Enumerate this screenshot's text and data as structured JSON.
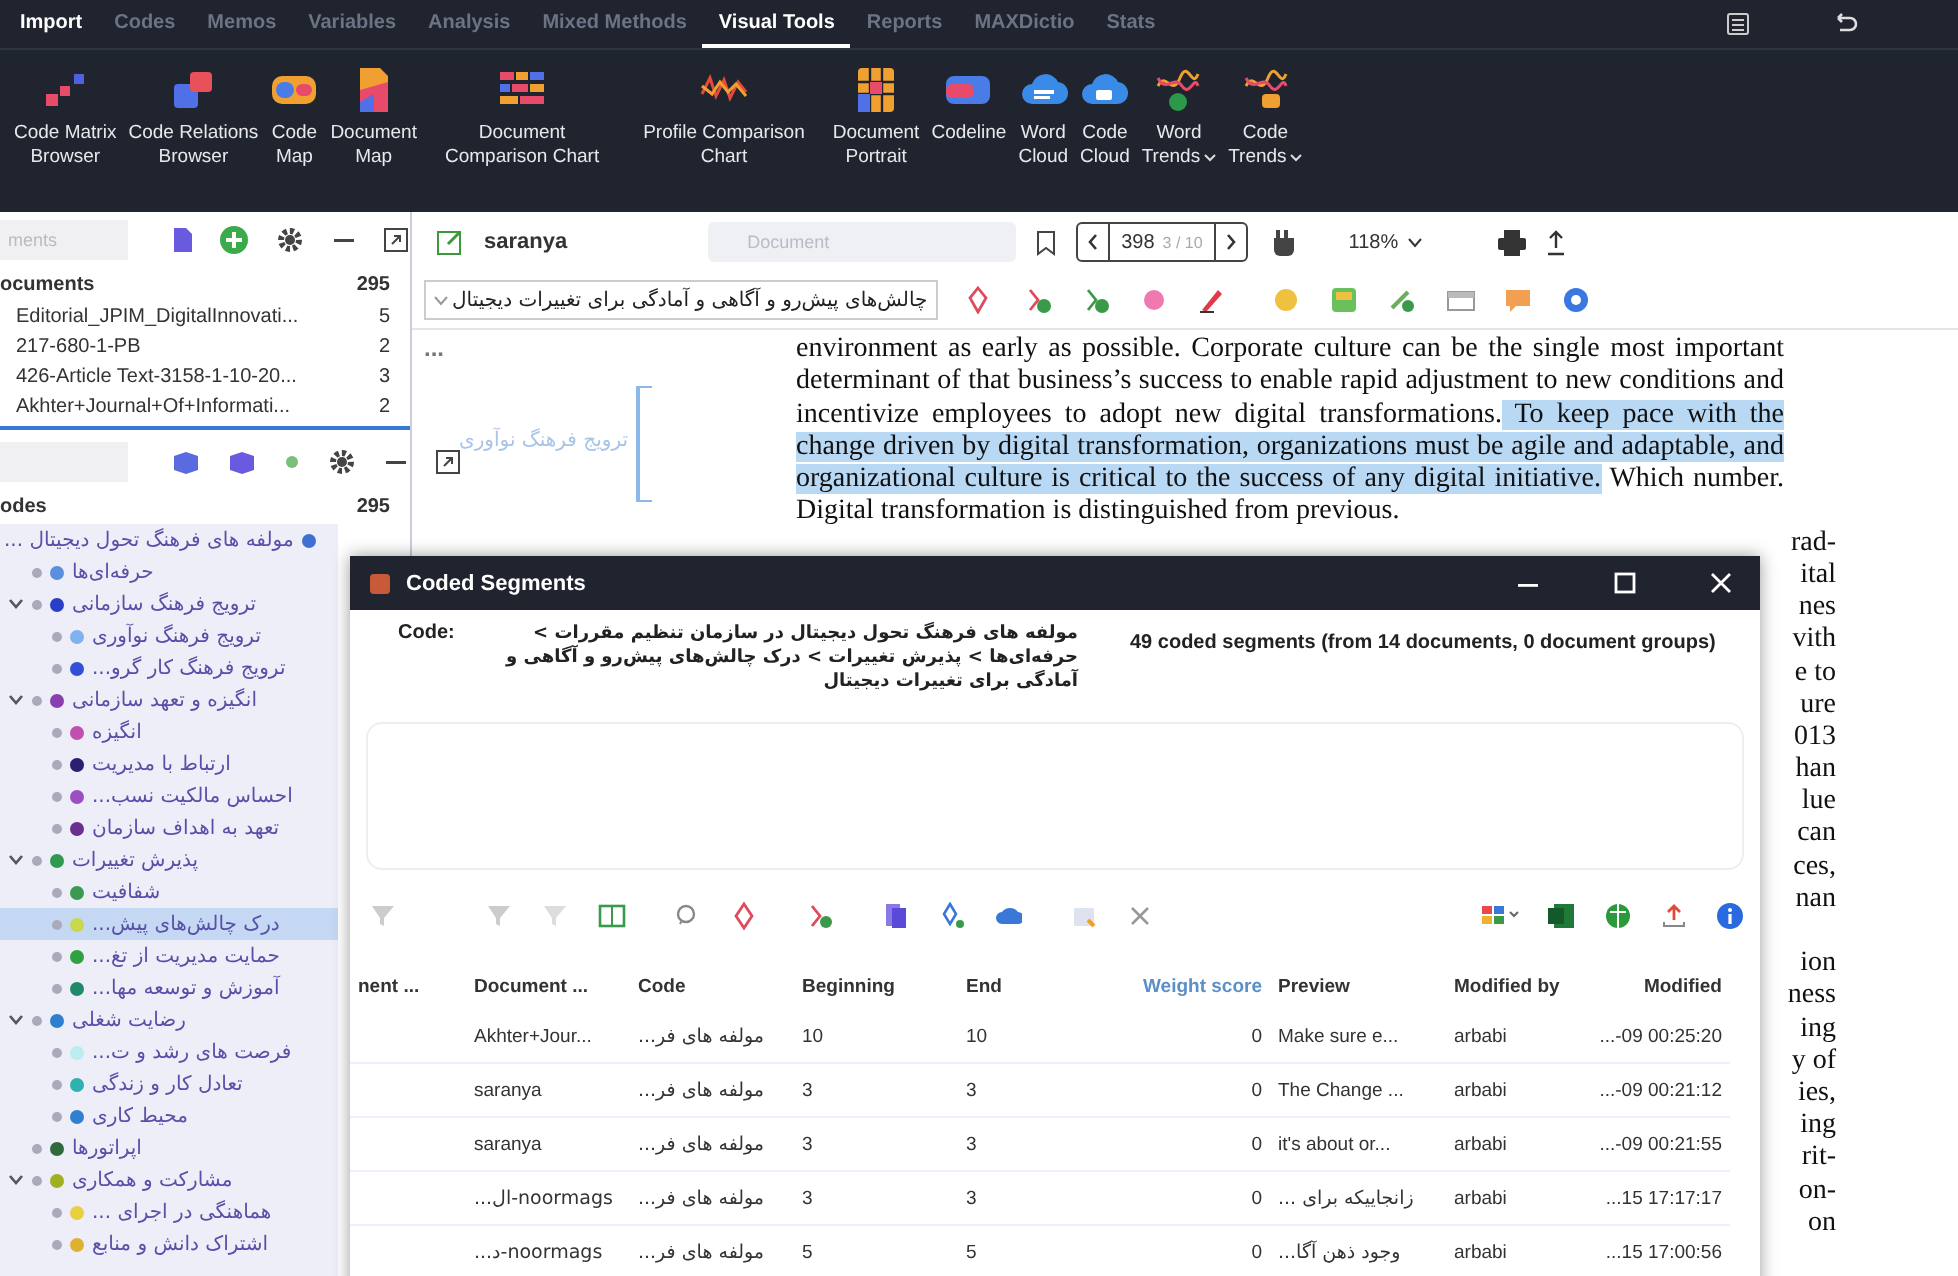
{
  "menu": {
    "tabs": [
      {
        "label": "Import",
        "selected": false
      },
      {
        "label": "Codes",
        "selected": false
      },
      {
        "label": "Memos",
        "selected": false
      },
      {
        "label": "Variables",
        "selected": false
      },
      {
        "label": "Analysis",
        "selected": false
      },
      {
        "label": "Mixed Methods",
        "selected": false
      },
      {
        "label": "Visual Tools",
        "selected": true
      },
      {
        "label": "Reports",
        "selected": false
      },
      {
        "label": "MAXDictio",
        "selected": false
      },
      {
        "label": "Stats",
        "selected": false
      }
    ]
  },
  "ribbon": [
    {
      "lines": [
        "Code Matrix",
        "Browser"
      ],
      "has_menu": false
    },
    {
      "lines": [
        "Code Relations",
        "Browser"
      ],
      "has_menu": false
    },
    {
      "lines": [
        "Code",
        "Map"
      ],
      "has_menu": false
    },
    {
      "lines": [
        "Document",
        "Map"
      ],
      "has_menu": false
    },
    {
      "lines": [
        "Document",
        "Comparison Chart"
      ],
      "has_menu": false
    },
    {
      "lines": [
        "Profile Comparison",
        "Chart"
      ],
      "has_menu": false
    },
    {
      "lines": [
        "Document",
        "Portrait"
      ],
      "has_menu": false
    },
    {
      "lines": [
        "Codeline"
      ],
      "has_menu": false
    },
    {
      "lines": [
        "Word",
        "Cloud"
      ],
      "has_menu": false
    },
    {
      "lines": [
        "Code",
        "Cloud"
      ],
      "has_menu": false
    },
    {
      "lines": [
        "Word",
        "Trends"
      ],
      "has_menu": true
    },
    {
      "lines": [
        "Code",
        "Trends"
      ],
      "has_menu": true
    }
  ],
  "documents": {
    "search": {
      "placeholder": "ments"
    },
    "title": "ocuments",
    "count": "295",
    "rows": [
      {
        "name": "Editorial_JPIM_DigitalInnovati...",
        "count": "5"
      },
      {
        "name": "217-680-1-PB",
        "count": "2"
      },
      {
        "name": "426-Article Text-3158-1-10-20...",
        "count": "3"
      },
      {
        "name": "Akhter+Journal+Of+Informati...",
        "count": "2"
      }
    ]
  },
  "codes": {
    "title": "odes",
    "count": "295",
    "tree": [
      {
        "label": "مولفه های فرهنگ تحول دیجیتال ...",
        "color": "#3f6fd0",
        "selected": false,
        "children": [
          {
            "label": "حرفه‌ای‌ها",
            "color": "#5a8fe0",
            "selected": false
          },
          {
            "label": "ترویج فرهنگ سازمانی",
            "color": "#2a3fc8",
            "selected": false,
            "expanded": true,
            "children": [
              {
                "label": "ترویج فرهنگ نوآوری",
                "color": "#7fb2ee",
                "selected": false
              },
              {
                "label": "ترویج فرهنگ کار گرو...",
                "color": "#3050d8",
                "selected": false
              }
            ]
          },
          {
            "label": "انگیزه و تعهد سازمانی",
            "color": "#8a3fb0",
            "selected": false,
            "expanded": true,
            "children": [
              {
                "label": "انگیزه",
                "color": "#c04fb0",
                "selected": false
              },
              {
                "label": "ارتباط با مدیریت",
                "color": "#2a1f70",
                "selected": false
              },
              {
                "label": "احساس مالکیت نسب...",
                "color": "#9a50c0",
                "selected": false
              },
              {
                "label": "تعهد به اهداف سازمان",
                "color": "#6a3090",
                "selected": false
              }
            ]
          },
          {
            "label": "پذیرش تغییرات",
            "color": "#2f9a4f",
            "selected": false,
            "expanded": true,
            "children": [
              {
                "label": "شفافیت",
                "color": "#3a9a50",
                "selected": false
              },
              {
                "label": "درک چالش‌های پیش...",
                "color": "#c8d84a",
                "selected": true
              },
              {
                "label": "حمایت مدیریت از تغ...",
                "color": "#30a040",
                "selected": false
              },
              {
                "label": "آموزش و توسعه مها...",
                "color": "#1f8a6a",
                "selected": false
              }
            ]
          },
          {
            "label": "رضایت شغلی",
            "color": "#2f7fd0",
            "selected": false,
            "expanded": true,
            "children": [
              {
                "label": "فرصت های رشد و ت...",
                "color": "#b8eef0",
                "selected": false
              },
              {
                "label": "تعادل کار و زندگی",
                "color": "#30b0b0",
                "selected": false
              },
              {
                "label": "محیط کاری",
                "color": "#3080d0",
                "selected": false
              }
            ]
          },
          {
            "label": "اپراتورها",
            "color": "#2f6a3f",
            "selected": false
          },
          {
            "label": "مشارکت و همکاری",
            "color": "#a0b020",
            "selected": false,
            "expanded": true,
            "children": [
              {
                "label": "هماهنگی در اجرای ...",
                "color": "#e8d040",
                "selected": false
              },
              {
                "label": "اشتراک دانش و منابع",
                "color": "#e0b030",
                "selected": false
              }
            ]
          }
        ]
      }
    ]
  },
  "viewer": {
    "document": "saranya",
    "search": {
      "placeholder": "Document"
    },
    "page": "398",
    "page_count": "3 / 10",
    "zoom": "118%",
    "code_select": "چالش‌های پیش‌رو و آگاهی و آمادگی برای تغییرات دیجیتال",
    "margin_more": "...",
    "margin_code": "ترویج فرهنگ نوآوری",
    "paragraph": [
      {
        "text": "environment as early as possible. Corporate culture can be the single most important determinant of that business’s success to enable rapid adjustment to new conditions and incentivize employees to adopt new digital transformations.",
        "highlighted": false
      },
      {
        "text": " To keep pace with the change driven by digital transformation, organizations must be agile and adaptable, and organizational culture is critical to the success of any digital initiative.",
        "highlighted": true
      },
      {
        "text": " Which number. Digital transformation is distinguished from previous.",
        "highlighted": false
      }
    ],
    "edge_fragments": [
      [
        "rad-",
        "ital",
        "nes",
        "vith",
        "e to",
        "ure",
        "013",
        "han",
        "lue",
        "can",
        "ces,",
        "nan"
      ],
      [
        "ion",
        "ness",
        "ing",
        "y of",
        "ies,",
        "ing",
        "rit-",
        "on-",
        "on"
      ]
    ]
  },
  "dialog": {
    "title": "Coded Segments",
    "code_label": "Code:",
    "code_path": "مولفه های فرهنگ تحول دیجیتال در سازمان تنظیم مقررات > حرفه‌ای‌ها > پذیرش تغییرات > درک چالش‌های پیش‌رو و آگاهی و آمادگی برای تغییرات دیجیتال",
    "summary": "49 coded segments (from 14 documents, 0 document groups)",
    "table": {
      "columns": [
        {
          "label": "nent ...",
          "sorted": false
        },
        {
          "label": "Document ...",
          "sorted": false
        },
        {
          "label": "Code",
          "sorted": false
        },
        {
          "label": "Beginning",
          "sorted": false
        },
        {
          "label": "End",
          "sorted": false
        },
        {
          "label": "Weight score",
          "sorted": true
        },
        {
          "label": "Preview",
          "sorted": false
        },
        {
          "label": "Modified by",
          "sorted": false
        },
        {
          "label": "Modified",
          "sorted": false
        }
      ],
      "rows": [
        [
          "",
          "Akhter+Jour...",
          "مولفه های فر...",
          "10",
          "10",
          "0",
          "Make sure e...",
          "arbabi",
          "...-09 00:25:20"
        ],
        [
          "",
          "saranya",
          "مولفه های فر...",
          "3",
          "3",
          "0",
          "The Change ...",
          "arbabi",
          "...-09 00:21:12"
        ],
        [
          "",
          "saranya",
          "مولفه های فر...",
          "3",
          "3",
          "0",
          "it's about or...",
          "arbabi",
          "...-09 00:21:55"
        ],
        [
          "",
          "noormags-ال...",
          "مولفه های فر...",
          "3",
          "3",
          "0",
          "زانجاییکه برای ...",
          "arbabi",
          "...15 17:17:17"
        ],
        [
          "",
          "noormags-د...",
          "مولفه های فر...",
          "5",
          "5",
          "0",
          "وجود ذهن آگا...",
          "arbabi",
          "...15 17:00:56"
        ]
      ]
    }
  }
}
